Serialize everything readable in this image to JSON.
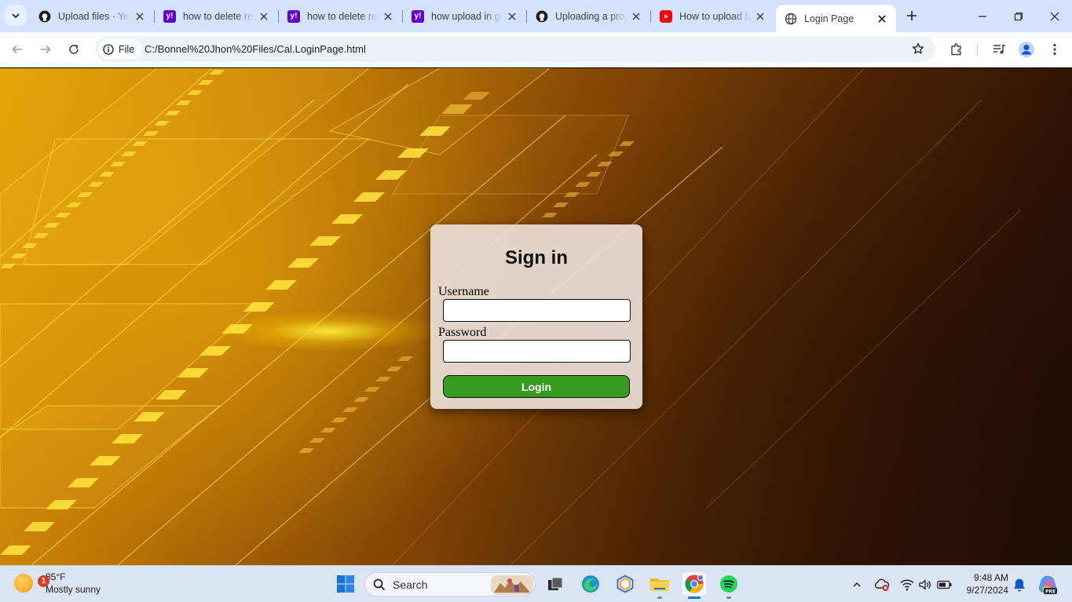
{
  "browser": {
    "tabs": [
      {
        "title": "Upload files · Yeyy",
        "icon": "github-icon"
      },
      {
        "title": "how to delete repository",
        "icon": "yahoo-icon"
      },
      {
        "title": "how to delete repository",
        "icon": "yahoo-icon"
      },
      {
        "title": "how upload in github",
        "icon": "yahoo-icon"
      },
      {
        "title": "Uploading a project",
        "icon": "github-icon"
      },
      {
        "title": "How to upload files",
        "icon": "youtube-icon"
      },
      {
        "title": "Login Page",
        "icon": "globe-icon"
      }
    ],
    "address": {
      "scheme_label": "File",
      "url": "C:/Bonnel%20Jhon%20Files/Cal.LoginPage.html"
    }
  },
  "login": {
    "title": "Sign in",
    "username_label": "Username",
    "username_value": "",
    "password_label": "Password",
    "password_value": "",
    "button_label": "Login"
  },
  "taskbar": {
    "weather": {
      "badge": "1",
      "temp": "85°F",
      "condition": "Mostly sunny"
    },
    "search_placeholder": "Search",
    "time": "9:48 AM",
    "date": "9/27/2024"
  },
  "colors": {
    "tabstrip": "#d3e3fd",
    "login_button": "#359a1f",
    "card": "#e8ded6"
  }
}
